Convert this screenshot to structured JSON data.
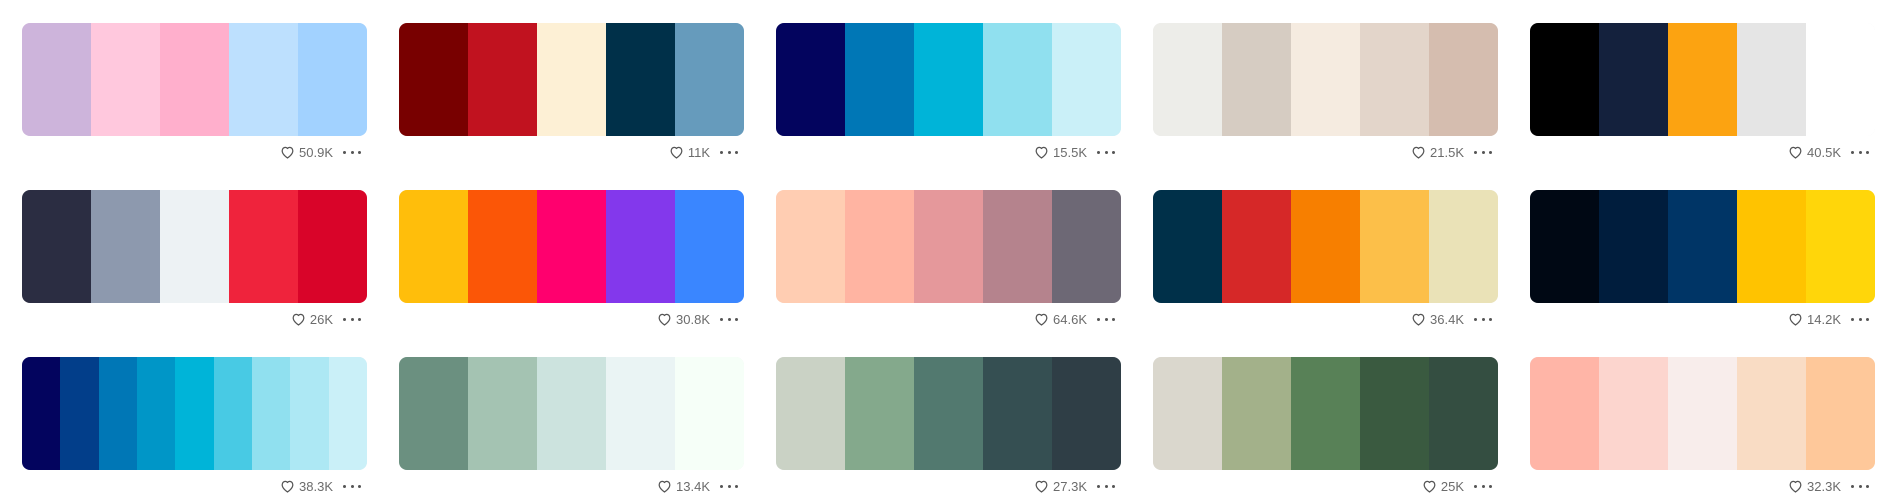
{
  "icons": {
    "like": "heart-icon",
    "more": "more-options-icon"
  },
  "palettes": [
    {
      "likes": "50.9K",
      "colors": [
        "#CDB4DB",
        "#FFC8DD",
        "#FFAFCC",
        "#BDE0FE",
        "#A2D2FF"
      ]
    },
    {
      "likes": "11K",
      "colors": [
        "#780000",
        "#C1121F",
        "#FDF0D5",
        "#003049",
        "#669BBC"
      ]
    },
    {
      "likes": "15.5K",
      "colors": [
        "#03045E",
        "#0077B6",
        "#00B4D8",
        "#90E0EF",
        "#CAF0F8"
      ]
    },
    {
      "likes": "21.5K",
      "colors": [
        "#EDEDE9",
        "#D6CCC2",
        "#F5EBE0",
        "#E3D5CA",
        "#D5BDAF"
      ]
    },
    {
      "likes": "40.5K",
      "colors": [
        "#000000",
        "#14213D",
        "#FCA311",
        "#E5E5E5",
        "#FFFFFF"
      ]
    },
    {
      "likes": "26K",
      "colors": [
        "#2B2D42",
        "#8D99AE",
        "#EDF2F4",
        "#EF233C",
        "#D90429"
      ]
    },
    {
      "likes": "30.8K",
      "colors": [
        "#FFBE0B",
        "#FB5607",
        "#FF006E",
        "#8338EC",
        "#3A86FF"
      ]
    },
    {
      "likes": "64.6K",
      "colors": [
        "#FFCDB2",
        "#FFB4A2",
        "#E5989B",
        "#B5838D",
        "#6D6875"
      ]
    },
    {
      "likes": "36.4K",
      "colors": [
        "#003049",
        "#D62828",
        "#F77F00",
        "#FCBF49",
        "#EAE2B7"
      ]
    },
    {
      "likes": "14.2K",
      "colors": [
        "#000814",
        "#001D3D",
        "#003566",
        "#FFC300",
        "#FFD60A"
      ]
    },
    {
      "likes": "38.3K",
      "colors": [
        "#03045E",
        "#023E8A",
        "#0077B6",
        "#0096C7",
        "#00B4D8",
        "#48CAE4",
        "#90E0EF",
        "#ADE8F4",
        "#CAF0F8"
      ]
    },
    {
      "likes": "13.4K",
      "colors": [
        "#6B9080",
        "#A4C3B2",
        "#CCE3DE",
        "#EAF4F4",
        "#F6FFF8"
      ]
    },
    {
      "likes": "27.3K",
      "colors": [
        "#CAD2C5",
        "#84A98C",
        "#52796F",
        "#354F52",
        "#2F3E46"
      ]
    },
    {
      "likes": "25K",
      "colors": [
        "#DAD7CD",
        "#A3B18A",
        "#588157",
        "#3A5A40",
        "#344E41"
      ]
    },
    {
      "likes": "32.3K",
      "colors": [
        "#FFB5A7",
        "#FCD5CE",
        "#F8EDEB",
        "#F9DCC4",
        "#FEC89A"
      ]
    }
  ]
}
